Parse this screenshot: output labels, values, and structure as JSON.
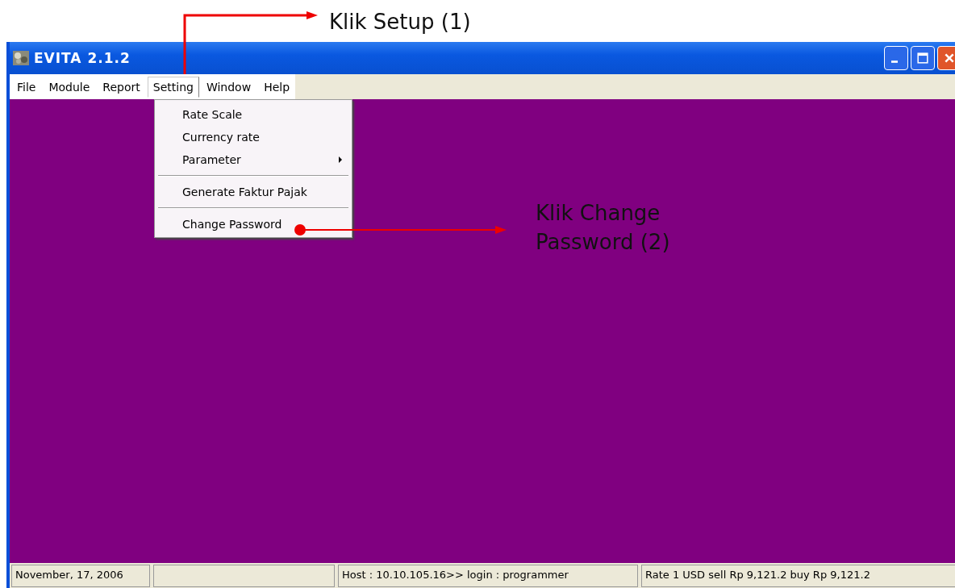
{
  "window": {
    "title": "EVITA 2.1.2"
  },
  "menu_bar": [
    {
      "label": "File",
      "selected": false
    },
    {
      "label": "Module",
      "selected": false
    },
    {
      "label": "Report",
      "selected": false
    },
    {
      "label": "Setting",
      "selected": true
    },
    {
      "label": "Window",
      "selected": false
    },
    {
      "label": "Help",
      "selected": false
    }
  ],
  "dropdown": [
    {
      "kind": "item",
      "label": "Rate Scale",
      "submenu": false
    },
    {
      "kind": "item",
      "label": "Currency rate",
      "submenu": false
    },
    {
      "kind": "item",
      "label": "Parameter",
      "submenu": true
    },
    {
      "kind": "separator"
    },
    {
      "kind": "item",
      "label": "Generate Faktur Pajak",
      "submenu": false
    },
    {
      "kind": "separator"
    },
    {
      "kind": "item",
      "label": "Change Password",
      "submenu": false
    }
  ],
  "status_bar": [
    {
      "kind": "text",
      "text": "November, 17, 2006"
    },
    {
      "kind": "blank"
    },
    {
      "kind": "text",
      "text": "Host : 10.10.105.16>> login : programmer"
    },
    {
      "kind": "text",
      "text": "Rate 1 USD sell Rp 9,121.2  buy Rp 9,121.2"
    }
  ],
  "annotations": [
    "Klik Setup (1)",
    "Klik Change\nPassword (2)"
  ]
}
